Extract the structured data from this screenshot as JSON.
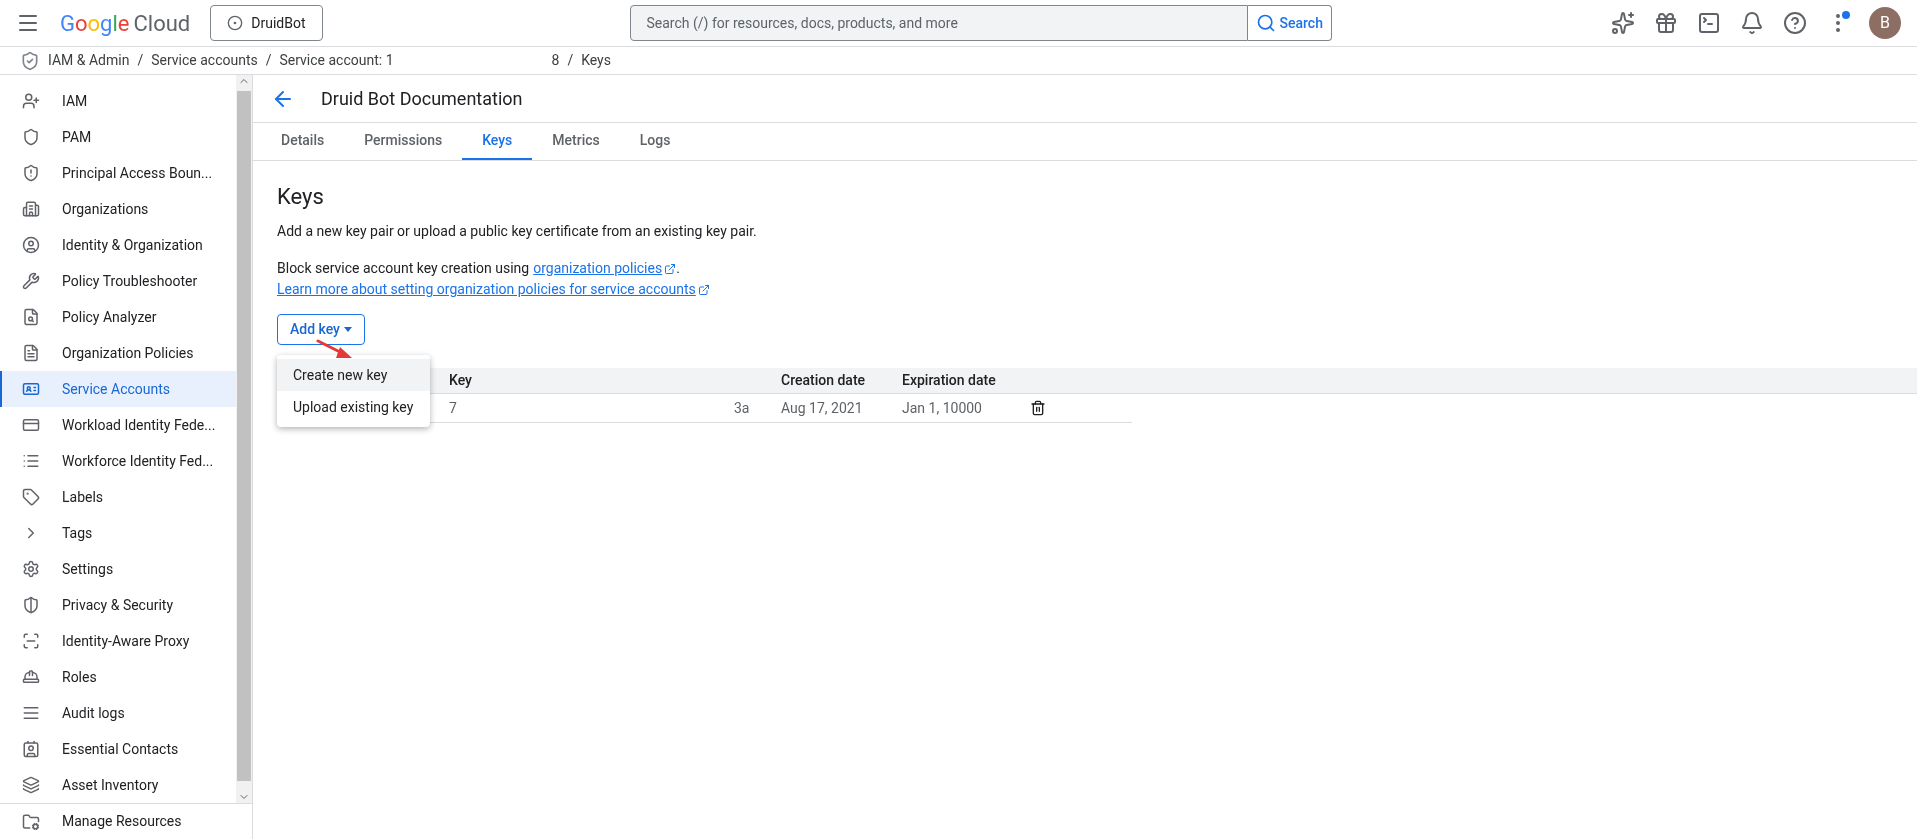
{
  "topbar": {
    "logo_word": "Google",
    "logo_suffix": "Cloud",
    "project": "DruidBot",
    "search": {
      "placeholder": "Search (/) for resources, docs, products, and more",
      "button": "Search"
    },
    "notification_dot": true,
    "avatar": "B"
  },
  "breadcrumb": [
    {
      "label": "IAM & Admin"
    },
    {
      "separator": "/",
      "label": "Service accounts"
    },
    {
      "separator": "/",
      "label": "Service account: 1"
    },
    {
      "label": "8"
    },
    {
      "separator": "/",
      "label": "Keys"
    }
  ],
  "sidebar": {
    "items": [
      {
        "label": "IAM",
        "selected": false
      },
      {
        "label": "PAM",
        "selected": false
      },
      {
        "label": "Principal Access Boun...",
        "selected": false
      },
      {
        "label": "Organizations",
        "selected": false
      },
      {
        "label": "Identity & Organization",
        "selected": false
      },
      {
        "label": "Policy Troubleshooter",
        "selected": false
      },
      {
        "label": "Policy Analyzer",
        "selected": false
      },
      {
        "label": "Organization Policies",
        "selected": false
      },
      {
        "label": "Service Accounts",
        "selected": true
      },
      {
        "label": "Workload Identity Fede...",
        "selected": false
      },
      {
        "label": "Workforce Identity Fed...",
        "selected": false
      },
      {
        "label": "Labels",
        "selected": false
      },
      {
        "label": "Tags",
        "selected": false
      },
      {
        "label": "Settings",
        "selected": false
      },
      {
        "label": "Privacy & Security",
        "selected": false
      },
      {
        "label": "Identity-Aware Proxy",
        "selected": false
      },
      {
        "label": "Roles",
        "selected": false
      },
      {
        "label": "Audit logs",
        "selected": false
      },
      {
        "label": "Essential Contacts",
        "selected": false
      },
      {
        "label": "Asset Inventory",
        "selected": false
      }
    ],
    "footer": "Manage Resources"
  },
  "page": {
    "title": "Druid Bot Documentation",
    "tabs": [
      {
        "label": "Details",
        "selected": false
      },
      {
        "label": "Permissions",
        "selected": false
      },
      {
        "label": "Keys",
        "selected": true
      },
      {
        "label": "Metrics",
        "selected": false
      },
      {
        "label": "Logs",
        "selected": false
      }
    ],
    "heading": "Keys",
    "description": "Add a new key pair or upload a public key certificate from an existing key pair.",
    "policy_text": "Block service account key creation using",
    "policy_link": "organization policies",
    "policy_end": ".",
    "learn_more": "Learn more about setting organization policies for service accounts",
    "add_key": "Add key",
    "menu": [
      {
        "label": "Create new key",
        "selected": true
      },
      {
        "label": "Upload existing key",
        "selected": false
      }
    ],
    "table": {
      "columns": [
        "Key",
        "Creation date",
        "Expiration date"
      ],
      "rows": [
        {
          "key_start": "7",
          "key_end": "3a",
          "created": "Aug 17, 2021",
          "expires": "Jan 1, 10000"
        }
      ]
    }
  }
}
